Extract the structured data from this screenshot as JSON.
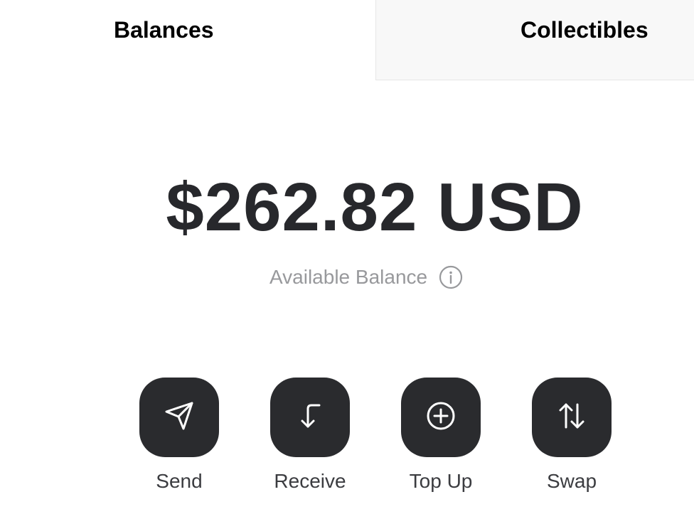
{
  "tabs": [
    {
      "label": "Balances",
      "active": true
    },
    {
      "label": "Collectibles",
      "active": false
    }
  ],
  "balance": {
    "amount": "$262.82 USD",
    "caption": "Available Balance",
    "info_icon": "info-icon"
  },
  "actions": [
    {
      "label": "Send",
      "icon": "send-icon"
    },
    {
      "label": "Receive",
      "icon": "receive-icon"
    },
    {
      "label": "Top Up",
      "icon": "top-up-icon"
    },
    {
      "label": "Swap",
      "icon": "swap-icon"
    }
  ],
  "colors": {
    "background": "#ffffff",
    "inactive_tab_bg": "#f8f8f8",
    "amount_text": "#27282c",
    "caption_text": "#98999c",
    "action_button": "#2a2b2e",
    "action_icon": "#ffffff"
  }
}
